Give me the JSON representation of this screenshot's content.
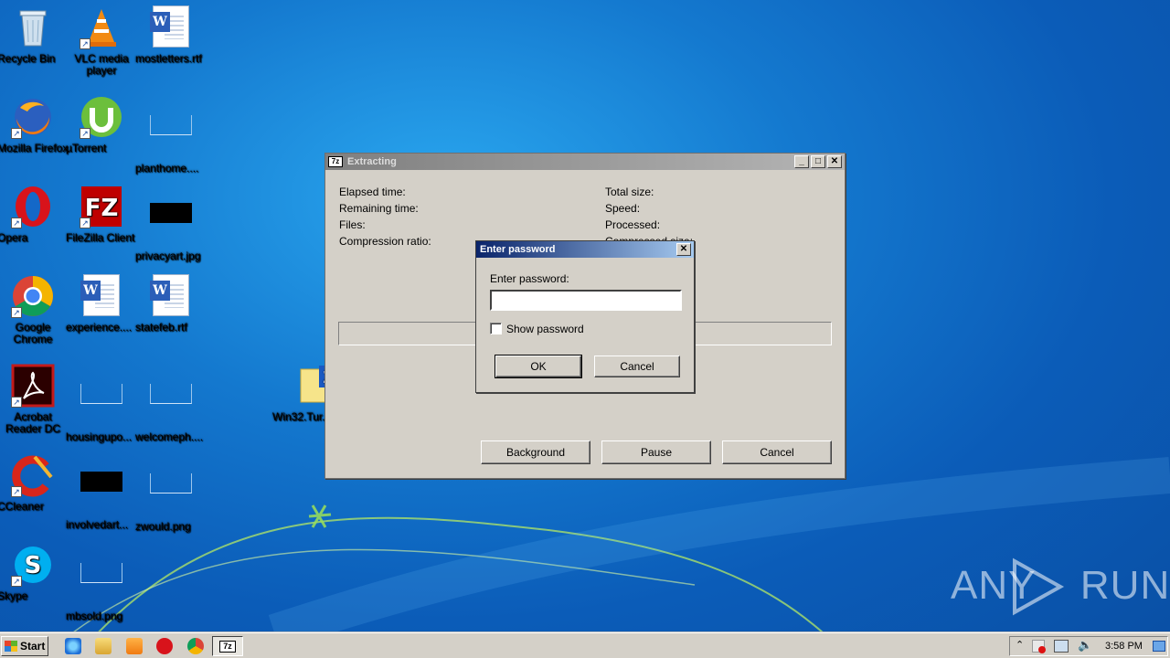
{
  "desktop": {
    "icons": [
      {
        "label": "Recycle Bin"
      },
      {
        "label": "VLC media player"
      },
      {
        "label": "mostletters.rtf"
      },
      {
        "label": "Mozilla Firefox"
      },
      {
        "label": "µTorrent"
      },
      {
        "label": "planthome...."
      },
      {
        "label": "Opera"
      },
      {
        "label": "FileZilla Client"
      },
      {
        "label": "privacyart.jpg"
      },
      {
        "label": "Google Chrome"
      },
      {
        "label": "experience...."
      },
      {
        "label": "statefeb.rtf"
      },
      {
        "label": "Acrobat Reader DC"
      },
      {
        "label": "housingupo..."
      },
      {
        "label": "welcomeph...."
      },
      {
        "label": "CCleaner"
      },
      {
        "label": "involvedart..."
      },
      {
        "label": "zwould.png"
      },
      {
        "label": "Skype"
      },
      {
        "label": "mbsold.png"
      },
      {
        "label": "Win32.Tur..."
      }
    ]
  },
  "extracting": {
    "title": "Extracting",
    "icon": "7z",
    "left_labels": [
      "Elapsed time:",
      "Remaining time:",
      "Files:",
      "Compression ratio:"
    ],
    "right_labels": [
      "Total size:",
      "Speed:",
      "Processed:",
      "Compressed size:"
    ],
    "progress": 0,
    "buttons": {
      "background": "Background",
      "pause": "Pause",
      "cancel": "Cancel"
    }
  },
  "password_dialog": {
    "title": "Enter password",
    "prompt": "Enter password:",
    "value": "",
    "show_password": "Show password",
    "show_password_checked": false,
    "ok": "OK",
    "cancel": "Cancel"
  },
  "taskbar": {
    "start": "Start",
    "active_task": "7z",
    "clock": "3:58 PM"
  },
  "watermark": "ANY RUN"
}
